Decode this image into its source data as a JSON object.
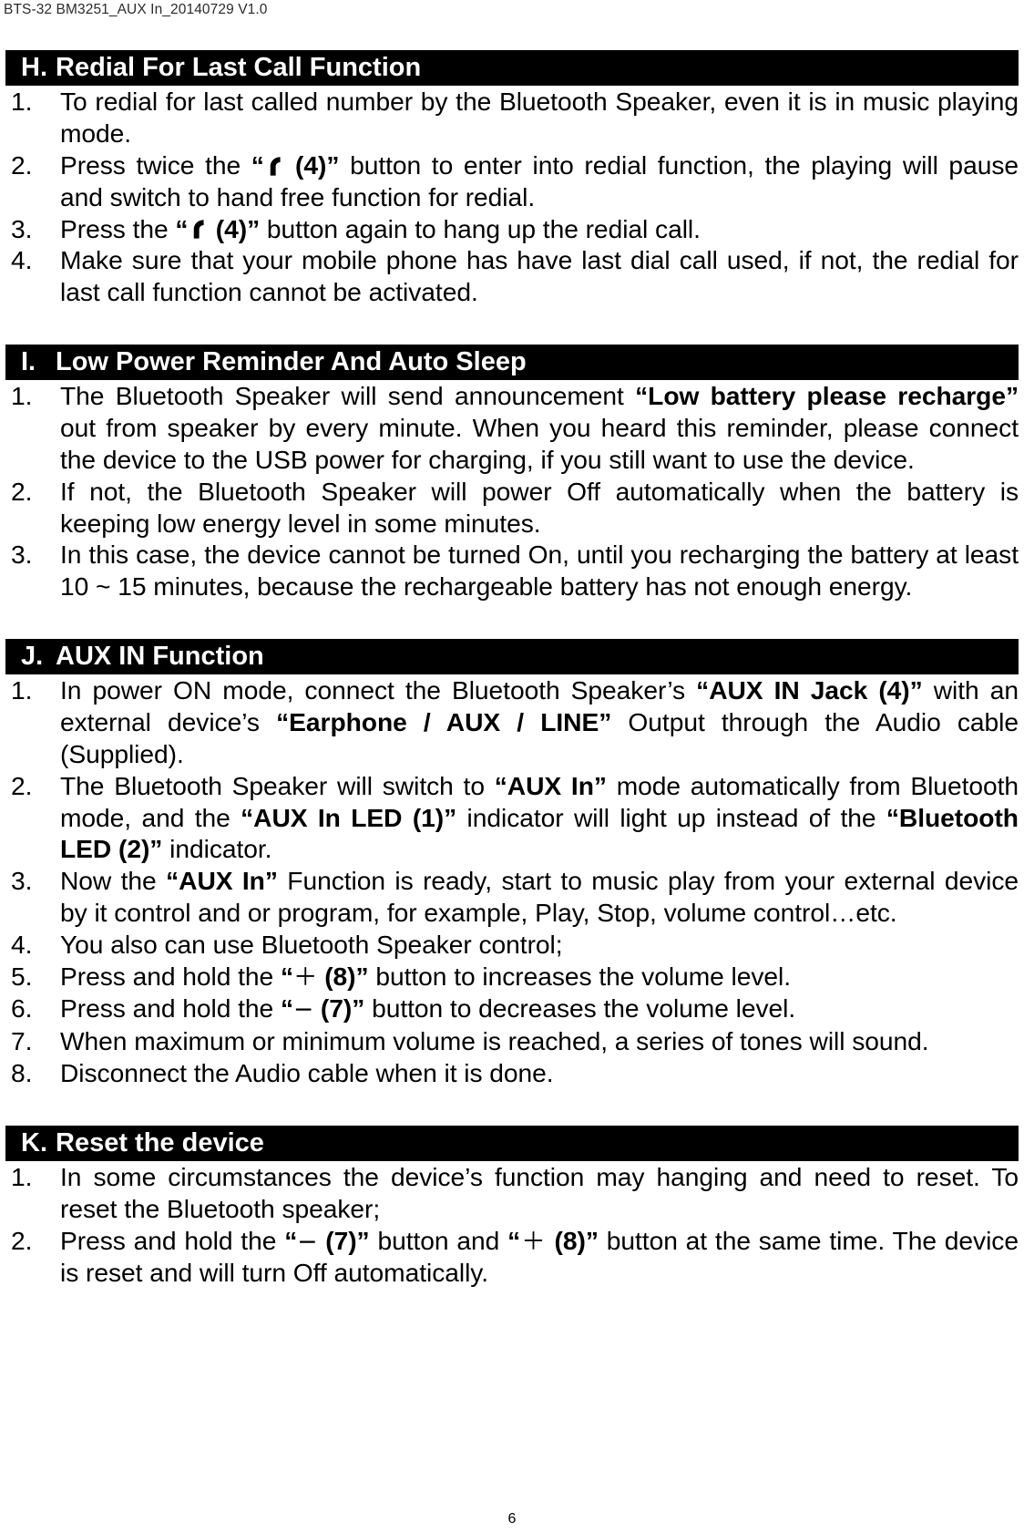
{
  "document": {
    "header_text": "BTS-32 BM3251_AUX In_20140729 V1.0",
    "page_number": "6"
  },
  "sections": [
    {
      "letter": "H.",
      "title": "Redial For Last Call Function",
      "items": [
        {
          "num": "1.",
          "segments": [
            {
              "type": "text",
              "value": "To redial for last called number by the Bluetooth Speaker, even it is in music playing mode."
            }
          ]
        },
        {
          "num": "2.",
          "segments": [
            {
              "type": "text",
              "value": "Press twice the "
            },
            {
              "type": "bold",
              "value": "“"
            },
            {
              "type": "phone-icon",
              "value": "phone-handset-icon"
            },
            {
              "type": "bold",
              "value": " (4)”"
            },
            {
              "type": "text",
              "value": " button to enter into redial function, the playing will pause and switch to hand free function for redial."
            }
          ]
        },
        {
          "num": "3.",
          "segments": [
            {
              "type": "text",
              "value": "Press the "
            },
            {
              "type": "bold",
              "value": "“"
            },
            {
              "type": "phone-icon",
              "value": "phone-handset-icon"
            },
            {
              "type": "bold",
              "value": " (4)”"
            },
            {
              "type": "text",
              "value": " button again to hang up the redial call."
            }
          ]
        },
        {
          "num": "4.",
          "segments": [
            {
              "type": "text",
              "value": "Make sure that your mobile phone has have last dial call used, if not, the redial for last call function cannot be activated."
            }
          ]
        }
      ]
    },
    {
      "letter": "I.",
      "title": "Low Power Reminder And Auto Sleep",
      "items": [
        {
          "num": "1.",
          "segments": [
            {
              "type": "text",
              "value": "The Bluetooth Speaker will send announcement "
            },
            {
              "type": "bold",
              "value": "“Low battery please recharge”"
            },
            {
              "type": "text",
              "value": " out from speaker by every minute. When you heard this reminder, please connect the device to the USB power for charging, if you still want to use the device."
            }
          ]
        },
        {
          "num": "2.",
          "segments": [
            {
              "type": "text",
              "value": "If not, the Bluetooth Speaker will power Off automatically when the battery is keeping low energy level in some minutes."
            }
          ]
        },
        {
          "num": "3.",
          "segments": [
            {
              "type": "text",
              "value": "In this case, the device cannot be turned On, until you recharging the battery at least 10 ~ 15 minutes, because the rechargeable battery has not enough energy."
            }
          ]
        }
      ]
    },
    {
      "letter": "J.",
      "title": "AUX IN Function",
      "items": [
        {
          "num": "1.",
          "segments": [
            {
              "type": "text",
              "value": "In power ON mode, connect the Bluetooth Speaker’s "
            },
            {
              "type": "bold",
              "value": "“AUX IN Jack (4)”"
            },
            {
              "type": "text",
              "value": " with an external device’s "
            },
            {
              "type": "bold",
              "value": "“Earphone / AUX / LINE”"
            },
            {
              "type": "text",
              "value": " Output through the Audio cable (Supplied)."
            }
          ]
        },
        {
          "num": "2.",
          "segments": [
            {
              "type": "text",
              "value": "The Bluetooth Speaker will switch to "
            },
            {
              "type": "bold",
              "value": "“AUX In”"
            },
            {
              "type": "text",
              "value": " mode automatically from Bluetooth mode, and the "
            },
            {
              "type": "bold",
              "value": "“AUX In LED (1)”"
            },
            {
              "type": "text",
              "value": " indicator will light up instead of the "
            },
            {
              "type": "bold",
              "value": "“Bluetooth LED (2)”"
            },
            {
              "type": "text",
              "value": " indicator."
            }
          ]
        },
        {
          "num": "3.",
          "segments": [
            {
              "type": "text",
              "value": "Now the "
            },
            {
              "type": "bold",
              "value": "“AUX In”"
            },
            {
              "type": "text",
              "value": " Function is ready, start to music play from your external device by it control and or program, for example, Play, Stop, volume control…etc."
            }
          ]
        },
        {
          "num": "4.",
          "segments": [
            {
              "type": "text",
              "value": "You also can use Bluetooth Speaker control;"
            }
          ]
        },
        {
          "num": "5.",
          "segments": [
            {
              "type": "text",
              "value": "Press and hold the "
            },
            {
              "type": "bold",
              "value": "“"
            },
            {
              "type": "symbol",
              "value": "＋"
            },
            {
              "type": "bold",
              "value": " (8)”"
            },
            {
              "type": "text",
              "value": " button to increases the volume level."
            }
          ]
        },
        {
          "num": "6.",
          "segments": [
            {
              "type": "text",
              "value": "Press and hold the "
            },
            {
              "type": "bold",
              "value": "“"
            },
            {
              "type": "symbol",
              "value": "−"
            },
            {
              "type": "bold",
              "value": " (7)”"
            },
            {
              "type": "text",
              "value": " button to decreases the volume level."
            }
          ]
        },
        {
          "num": "7.",
          "segments": [
            {
              "type": "text",
              "value": "When maximum or minimum volume is reached, a series of tones will sound."
            }
          ]
        },
        {
          "num": "8.",
          "segments": [
            {
              "type": "text",
              "value": "Disconnect the Audio cable when it is done."
            }
          ]
        }
      ]
    },
    {
      "letter": "K.",
      "title": "Reset the device",
      "items": [
        {
          "num": "1.",
          "segments": [
            {
              "type": "text",
              "value": "In some circumstances the device’s function may hanging and need to reset. To reset the Bluetooth speaker;"
            }
          ]
        },
        {
          "num": "2.",
          "segments": [
            {
              "type": "text",
              "value": "Press and hold the "
            },
            {
              "type": "bold",
              "value": "“"
            },
            {
              "type": "symbol",
              "value": "−"
            },
            {
              "type": "bold",
              "value": " (7)”"
            },
            {
              "type": "text",
              "value": " button and "
            },
            {
              "type": "bold",
              "value": "“"
            },
            {
              "type": "symbol",
              "value": "＋"
            },
            {
              "type": "bold",
              "value": " (8)”"
            },
            {
              "type": "text",
              "value": " button at the same time. The device is reset and will turn Off automatically."
            }
          ]
        }
      ]
    }
  ]
}
